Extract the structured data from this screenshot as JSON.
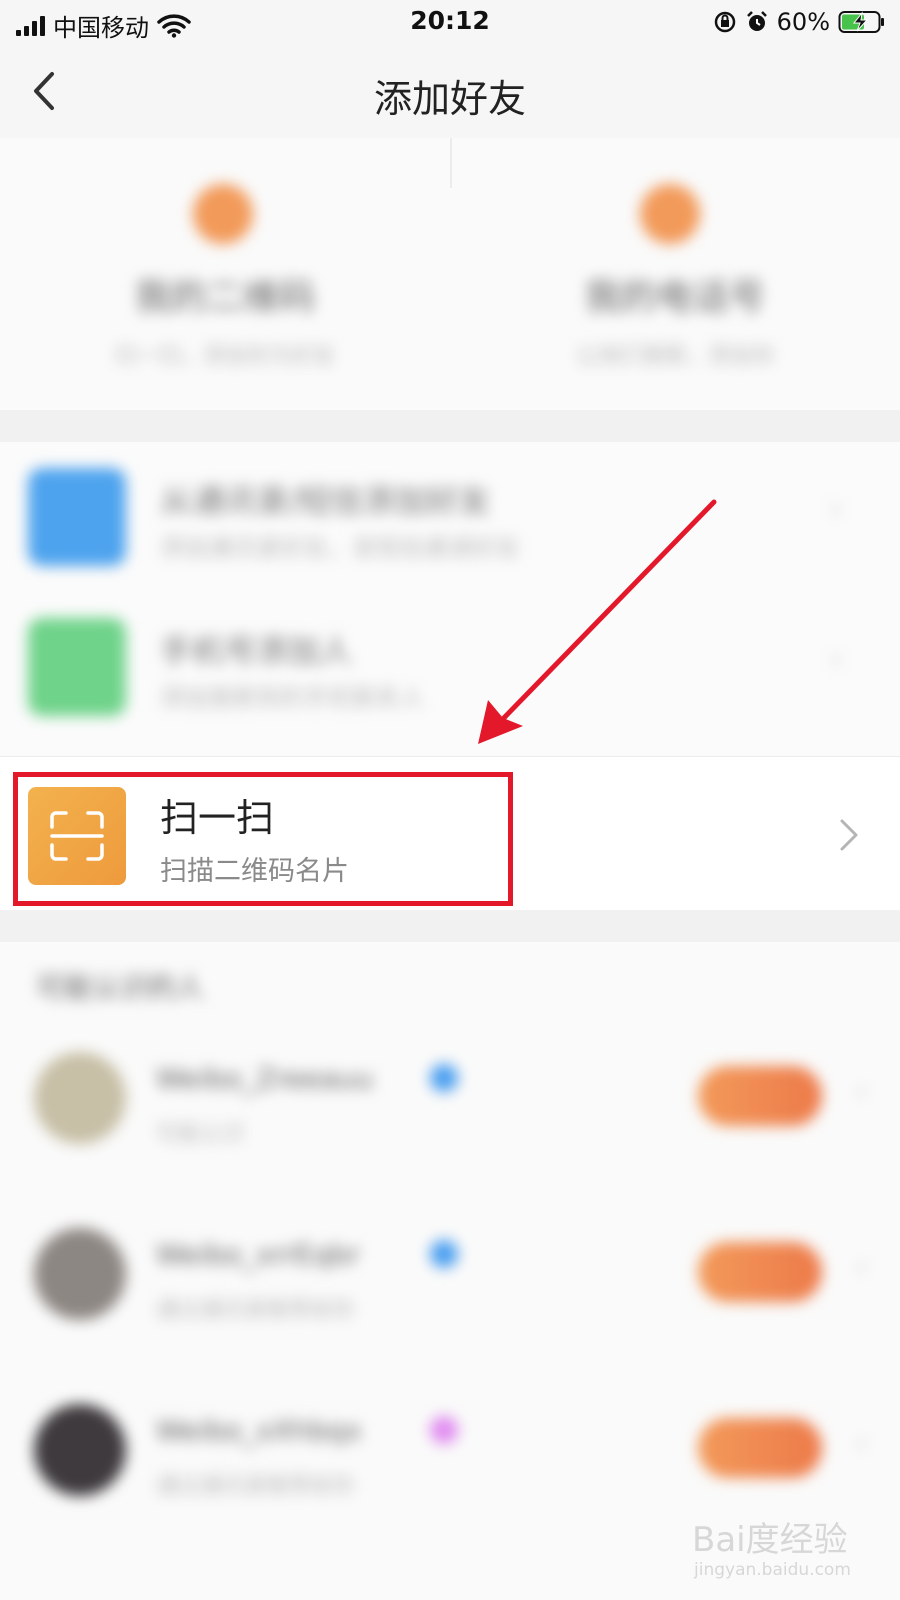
{
  "status_bar": {
    "carrier": "中国移动",
    "time": "20:12",
    "battery_percent": "60%"
  },
  "nav": {
    "title": "添加好友"
  },
  "qr_cards": [
    {
      "title": "我的二维码",
      "subtitle": "扫一扫，添加你为好友"
    },
    {
      "title": "我的电话号",
      "subtitle": "让他们搜索，添加你"
    }
  ],
  "list_items": [
    {
      "title": "从通讯录/短信添加好友",
      "subtitle": "添加通讯录好友，发短信邀请好友",
      "color": "#4ea3ee"
    },
    {
      "title": "手机号添加人",
      "subtitle": "添加搜索到的手机联系人",
      "color": "#6fd38a"
    }
  ],
  "scan": {
    "title": "扫一扫",
    "subtitle": "扫描二维码名片",
    "accent": "#f0a244"
  },
  "recommend": {
    "header": "可能认识的人",
    "items": [
      {
        "name": "Weibo_Zreeauu",
        "sub": "可能认识",
        "avatar_color": "#c7bfa6",
        "badge_color": "#4a9ef0"
      },
      {
        "name": "Weibo_xrrEqbr",
        "sub": "通过通讯录推荐给你",
        "avatar_color": "#8d8783",
        "badge_color": "#4a9ef0"
      },
      {
        "name": "Weibo_xXhbqx",
        "sub": "通过通讯录推荐给你",
        "avatar_color": "#3e3a3d",
        "badge_color": "#e08cf0"
      }
    ]
  },
  "annotation": {
    "highlight_color": "#e4182b"
  },
  "watermark": {
    "logo": "Bai度经验",
    "url": "jingyan.baidu.com"
  }
}
